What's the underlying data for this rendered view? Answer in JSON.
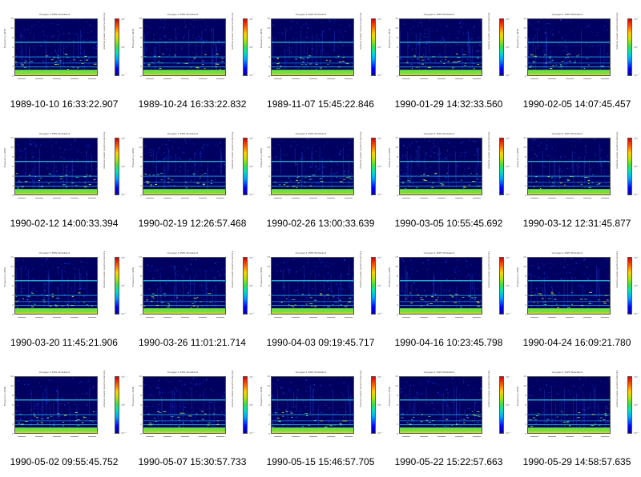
{
  "chart_data": {
    "type": "heatmap",
    "panels": [
      {
        "caption": "1989-10-10 16:33:22.907"
      },
      {
        "caption": "1989-10-24 16:33:22.832"
      },
      {
        "caption": "1989-11-07 15:45:22.846"
      },
      {
        "caption": "1990-01-29 14:32:33.560"
      },
      {
        "caption": "1990-02-05 14:07:45.457"
      },
      {
        "caption": "1990-02-12 14:00:33.394"
      },
      {
        "caption": "1990-02-19 12:26:57.468"
      },
      {
        "caption": "1990-02-26 13:00:33.639"
      },
      {
        "caption": "1990-03-05 10:55:45.692"
      },
      {
        "caption": "1990-03-12 12:31:45.877"
      },
      {
        "caption": "1990-03-20 11:45:21.906"
      },
      {
        "caption": "1990-03-26 11:01:21.714"
      },
      {
        "caption": "1990-04-03 09:19:45.717"
      },
      {
        "caption": "1990-04-16 10:23:45.798"
      },
      {
        "caption": "1990-04-24 16:09:21.780"
      },
      {
        "caption": "1990-05-02 09:55:45.752"
      },
      {
        "caption": "1990-05-07 15:30:57.733"
      },
      {
        "caption": "1990-05-15 15:46:57.705"
      },
      {
        "caption": "1990-05-22 15:22:57.663"
      },
      {
        "caption": "1990-05-29 14:58:57.635"
      }
    ],
    "panel_title": "Voyager-1 PWS Wideband",
    "ylabel": "Frequency (kHz)",
    "yticks": [
      "12",
      "10",
      "8",
      "6",
      "4",
      "2",
      "0"
    ],
    "colorbar_label": "relative power spectral density",
    "colorbar_ticks": [
      "10¹",
      "10⁰",
      "10⁻¹"
    ],
    "colormap": [
      "#0000a0",
      "#0000ff",
      "#00a0ff",
      "#00e0c0",
      "#40e040",
      "#c0e000",
      "#ffd000",
      "#ff6000",
      "#d00000"
    ],
    "background_color": "#000060"
  }
}
